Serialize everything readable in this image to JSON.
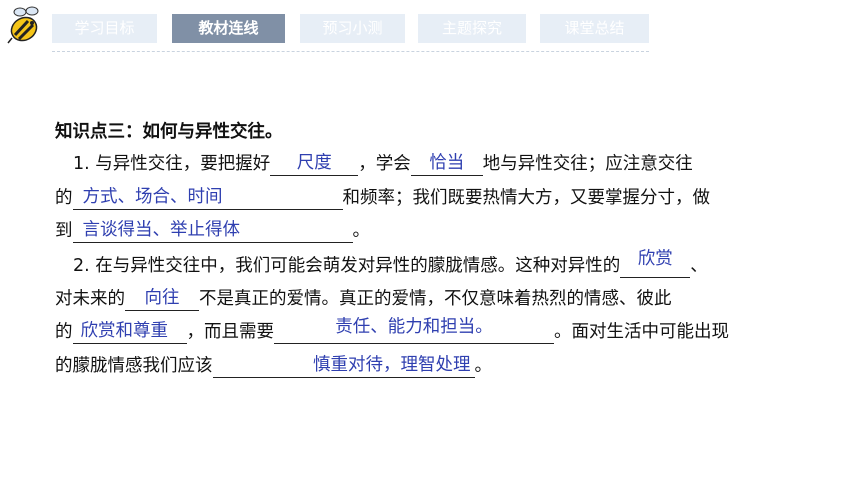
{
  "tabs": [
    {
      "label": "学习目标",
      "active": false
    },
    {
      "label": "教材连线",
      "active": true
    },
    {
      "label": "预习小测",
      "active": false
    },
    {
      "label": "主题探究",
      "active": false
    },
    {
      "label": "课堂总结",
      "active": false
    }
  ],
  "colors": {
    "tab_bg": "#e7eef6",
    "tab_active_bg": "#8090a6",
    "answer": "#2f3fb0"
  },
  "section": {
    "heading": "知识点三：如何与异性交往。",
    "p1_a": "1. 与异性交往，要把握好",
    "ans1": "尺度",
    "p1_b": "，学会",
    "ans2": "恰当",
    "p1_c": "地与异性交往；应注意交往",
    "p2_a": "的",
    "ans3": "方式、场合、时间",
    "p2_b": "和频率；我们既要热情大方，又要掌握分寸，做",
    "p3_a": "到",
    "ans4": "言谈得当、举止得体",
    "p3_b": "。",
    "p4_a": "2. 在与异性交往中，我们可能会萌发对异性的朦胧情感。这种对异性的",
    "ans5": "欣赏",
    "p4_b": "、",
    "p5_a": "对未来的",
    "ans6": "向往",
    "p5_b": "不是真正的爱情。真正的爱情，不仅意味着热烈的情感、彼此",
    "p6_a": "的",
    "ans7": "欣赏和尊重",
    "p6_b": "，而且需要",
    "ans8": "责任、能力和担当。",
    "p6_c": "。面对生活中可能出现",
    "p7_a": "的朦胧情感我们应该",
    "ans9": "慎重对待，理智处理",
    "p7_b": "。"
  }
}
